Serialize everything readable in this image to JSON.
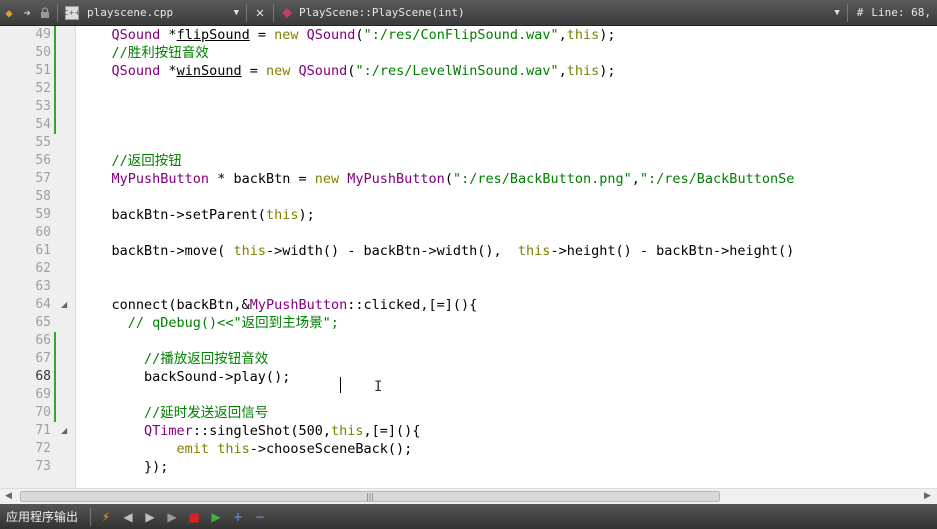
{
  "toolbar": {
    "back_icon": "◆",
    "forward_icon": "➜",
    "file_name": "playscene.cpp",
    "file_icon": "C++",
    "dropdown_icon": "▼",
    "close_icon": "✕",
    "symbol_name": "PlayScene::PlayScene(int)",
    "hash": "#",
    "line_info": "Line: 68,"
  },
  "editor": {
    "current_line": "68",
    "lines": [
      {
        "n": "49",
        "tokens": [
          [
            "    ",
            "p"
          ],
          [
            "QSound",
            "t"
          ],
          [
            " *",
            "p"
          ],
          [
            "flipSound",
            "u"
          ],
          [
            " = ",
            "p"
          ],
          [
            "new",
            "k"
          ],
          [
            " ",
            "p"
          ],
          [
            "QSound",
            "t"
          ],
          [
            "(",
            "p"
          ],
          [
            "\":/res/ConFlipSound.wav\"",
            "s"
          ],
          [
            ",",
            "p"
          ],
          [
            "this",
            "k"
          ],
          [
            ");",
            "p"
          ]
        ]
      },
      {
        "n": "50",
        "tokens": [
          [
            "    ",
            "p"
          ],
          [
            "//胜利按钮音效",
            "c"
          ]
        ]
      },
      {
        "n": "51",
        "tokens": [
          [
            "    ",
            "p"
          ],
          [
            "QSound",
            "t"
          ],
          [
            " *",
            "p"
          ],
          [
            "winSound",
            "u"
          ],
          [
            " = ",
            "p"
          ],
          [
            "new",
            "k"
          ],
          [
            " ",
            "p"
          ],
          [
            "QSound",
            "t"
          ],
          [
            "(",
            "p"
          ],
          [
            "\":/res/LevelWinSound.wav\"",
            "s"
          ],
          [
            ",",
            "p"
          ],
          [
            "this",
            "k"
          ],
          [
            ");",
            "p"
          ]
        ]
      },
      {
        "n": "52",
        "tokens": []
      },
      {
        "n": "53",
        "tokens": []
      },
      {
        "n": "54",
        "tokens": []
      },
      {
        "n": "55",
        "tokens": []
      },
      {
        "n": "56",
        "tokens": [
          [
            "    ",
            "p"
          ],
          [
            "//返回按钮",
            "c"
          ]
        ]
      },
      {
        "n": "57",
        "tokens": [
          [
            "    ",
            "p"
          ],
          [
            "MyPushButton",
            "t"
          ],
          [
            " * backBtn = ",
            "p"
          ],
          [
            "new",
            "k"
          ],
          [
            " ",
            "p"
          ],
          [
            "MyPushButton",
            "t"
          ],
          [
            "(",
            "p"
          ],
          [
            "\":/res/BackButton.png\"",
            "s"
          ],
          [
            ",",
            "p"
          ],
          [
            "\":/res/BackButtonSe",
            "s"
          ]
        ]
      },
      {
        "n": "58",
        "tokens": []
      },
      {
        "n": "59",
        "tokens": [
          [
            "    backBtn->setParent(",
            "p"
          ],
          [
            "this",
            "k"
          ],
          [
            ");",
            "p"
          ]
        ]
      },
      {
        "n": "60",
        "tokens": []
      },
      {
        "n": "61",
        "tokens": [
          [
            "    backBtn->move( ",
            "p"
          ],
          [
            "this",
            "k"
          ],
          [
            "->width() - backBtn->width(),  ",
            "p"
          ],
          [
            "this",
            "k"
          ],
          [
            "->height() - backBtn->height()",
            "p"
          ]
        ]
      },
      {
        "n": "62",
        "tokens": []
      },
      {
        "n": "63",
        "tokens": []
      },
      {
        "n": "64",
        "fold": true,
        "tokens": [
          [
            "    connect(backBtn,&",
            "p"
          ],
          [
            "MyPushButton",
            "t"
          ],
          [
            "::clicked,[=](){",
            "p"
          ]
        ]
      },
      {
        "n": "65",
        "tokens": [
          [
            "      ",
            "p"
          ],
          [
            "// qDebug()<<\"返回到主场景\";",
            "c"
          ]
        ]
      },
      {
        "n": "66",
        "tokens": []
      },
      {
        "n": "67",
        "tokens": [
          [
            "        ",
            "p"
          ],
          [
            "//播放返回按钮音效",
            "c"
          ]
        ]
      },
      {
        "n": "68",
        "tokens": [
          [
            "        backSound->play();",
            "p"
          ]
        ]
      },
      {
        "n": "69",
        "tokens": []
      },
      {
        "n": "70",
        "tokens": [
          [
            "        ",
            "p"
          ],
          [
            "//延时发送返回信号",
            "c"
          ]
        ]
      },
      {
        "n": "71",
        "fold": true,
        "tokens": [
          [
            "        ",
            "p"
          ],
          [
            "QTimer",
            "t"
          ],
          [
            "::singleShot(500,",
            "p"
          ],
          [
            "this",
            "k"
          ],
          [
            ",[=](){",
            "p"
          ]
        ]
      },
      {
        "n": "72",
        "tokens": [
          [
            "            ",
            "p"
          ],
          [
            "emit",
            "k"
          ],
          [
            " ",
            "p"
          ],
          [
            "this",
            "k"
          ],
          [
            "->chooseSceneBack();",
            "p"
          ]
        ]
      },
      {
        "n": "73",
        "tokens": [
          [
            "        });",
            "p"
          ]
        ]
      }
    ]
  },
  "scrollbar": {
    "left_icon": "◀",
    "right_icon": "▶",
    "grip": "|||"
  },
  "output": {
    "title": "应用程序输出",
    "buttons": [
      {
        "name": "attach-icon",
        "glyph": "⚡",
        "color": "#e0a030"
      },
      {
        "name": "prev-icon",
        "glyph": "◀",
        "color": "#c0c0c0"
      },
      {
        "name": "next-icon",
        "glyph": "▶",
        "color": "#c0c0c0"
      },
      {
        "name": "run-icon",
        "glyph": "▶",
        "color": "#9a9a9a"
      },
      {
        "name": "stop-icon",
        "glyph": "■",
        "color": "#e02020"
      },
      {
        "name": "debug-run-icon",
        "glyph": "▶",
        "color": "#40b040"
      },
      {
        "name": "zoom-in-icon",
        "glyph": "+",
        "color": "#5aa0ff"
      },
      {
        "name": "zoom-out-icon",
        "glyph": "−",
        "color": "#5aa0ff"
      }
    ]
  },
  "colors": {
    "keyword": "#808000",
    "type": "#800080",
    "string": "#008000",
    "comment": "#008000",
    "plain": "#000000",
    "changebar": "#3aa03a"
  }
}
